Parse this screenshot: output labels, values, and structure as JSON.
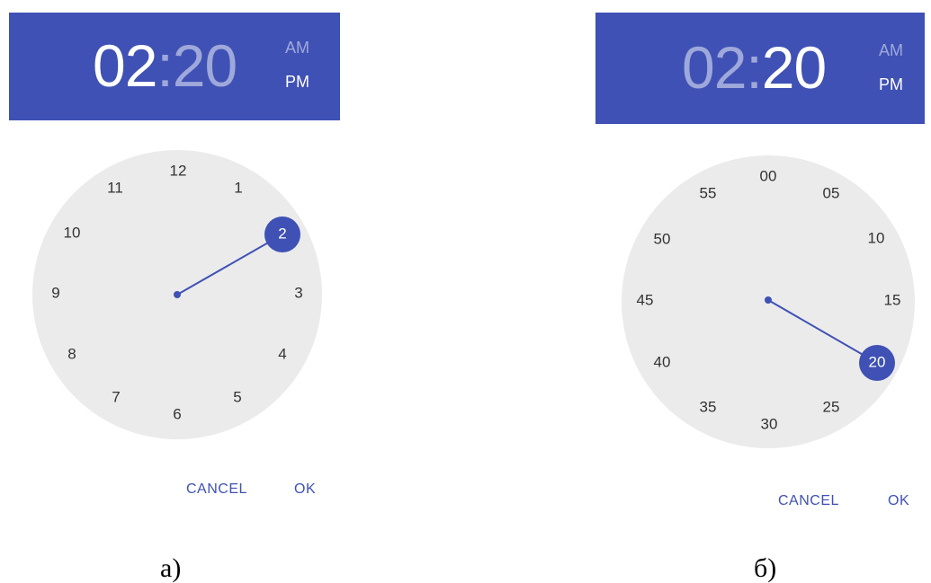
{
  "colors": {
    "primary": "#3f51b5",
    "dial_bg": "#ebebeb",
    "text": "#333333"
  },
  "picker_a": {
    "mode": "hours",
    "hours": "02",
    "separator": ":",
    "minutes": "20",
    "am_label": "AM",
    "pm_label": "PM",
    "active_field": "hours",
    "active_period": "PM",
    "dial_labels": [
      "12",
      "1",
      "2",
      "3",
      "4",
      "5",
      "6",
      "7",
      "8",
      "9",
      "10",
      "11"
    ],
    "selected_label": "2",
    "cancel_label": "CANCEL",
    "ok_label": "OK",
    "caption": "а)"
  },
  "picker_b": {
    "mode": "minutes",
    "hours": "02",
    "separator": ":",
    "minutes": "20",
    "am_label": "AM",
    "pm_label": "PM",
    "active_field": "minutes",
    "active_period": "PM",
    "dial_labels": [
      "00",
      "05",
      "10",
      "15",
      "20",
      "25",
      "30",
      "35",
      "40",
      "45",
      "50",
      "55"
    ],
    "selected_label": "20",
    "cancel_label": "CANCEL",
    "ok_label": "OK",
    "caption": "б)"
  }
}
